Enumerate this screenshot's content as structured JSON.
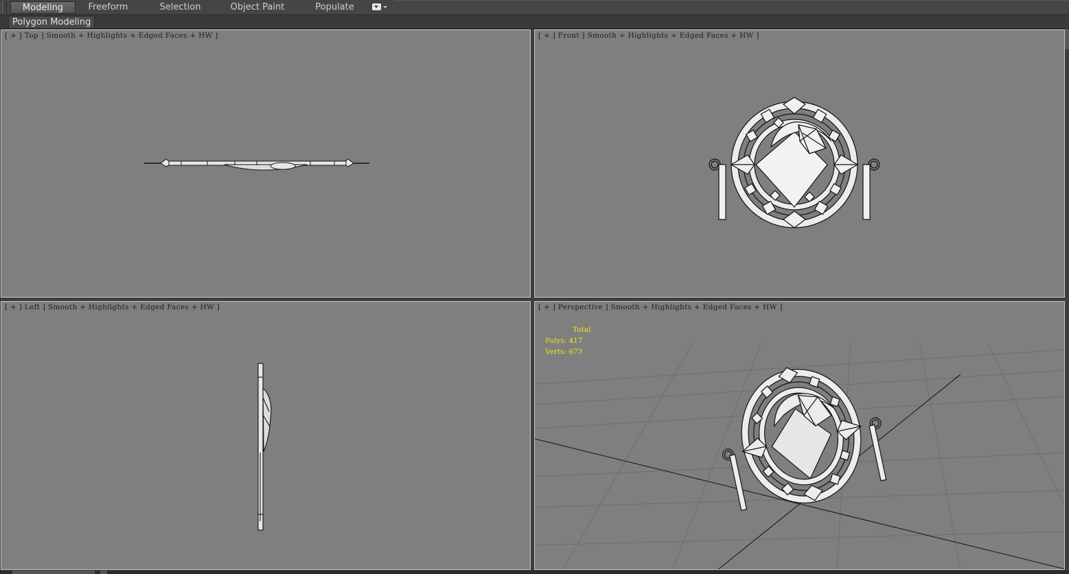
{
  "ribbon": {
    "tabs": [
      {
        "label": "Modeling",
        "active": true
      },
      {
        "label": "Freeform",
        "active": false
      },
      {
        "label": "Selection",
        "active": false
      },
      {
        "label": "Object Paint",
        "active": false
      },
      {
        "label": "Populate",
        "active": false
      }
    ],
    "more_icon": "dropdown-toggle-icon"
  },
  "panel": {
    "label": "Polygon Modeling"
  },
  "viewports": {
    "top": {
      "label": "[ + ] Top ] Smooth + Highlights + Edged Faces + HW ]"
    },
    "front": {
      "label": "[ + ] Front ] Smooth + Highlights + Edged Faces + HW ]"
    },
    "left": {
      "label": "[ + ] Left ] Smooth + Highlights + Edged Faces + HW ]"
    },
    "perspective": {
      "label": "[ + ] Perspective ] Smooth + Highlights + Edged Faces + HW ]",
      "stats": {
        "header": "Total",
        "polys": "Polys: 417",
        "verts": "Verts: 673"
      }
    }
  },
  "colors": {
    "viewport_bg": "#7f7f7f",
    "stats_text": "#f2e31a",
    "ui_bg": "#3c3c3c"
  }
}
